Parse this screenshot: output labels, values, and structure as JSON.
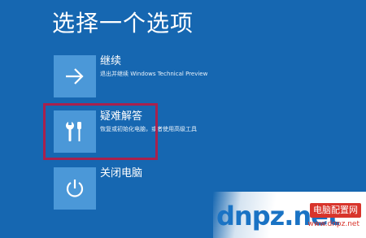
{
  "page": {
    "title": "选择一个选项"
  },
  "options": [
    {
      "icon": "arrow-right-icon",
      "title": "继续",
      "description": "退出并继续 Windows Technical Preview"
    },
    {
      "icon": "tools-icon",
      "title": "疑难解答",
      "description": "恢复或初始化电脑，或者使用高级工具"
    },
    {
      "icon": "power-icon",
      "title": "关闭电脑",
      "description": ""
    }
  ],
  "watermark": {
    "logo_text": "dnpz.net",
    "site_name": "电脑配置网",
    "url": "www.dnpz.net"
  },
  "colors": {
    "background": "#1667b1",
    "tile": "#4b98d8",
    "highlight_border": "#a8214d",
    "watermark_blue": "#1a73c4",
    "watermark_red": "#d8342b"
  }
}
